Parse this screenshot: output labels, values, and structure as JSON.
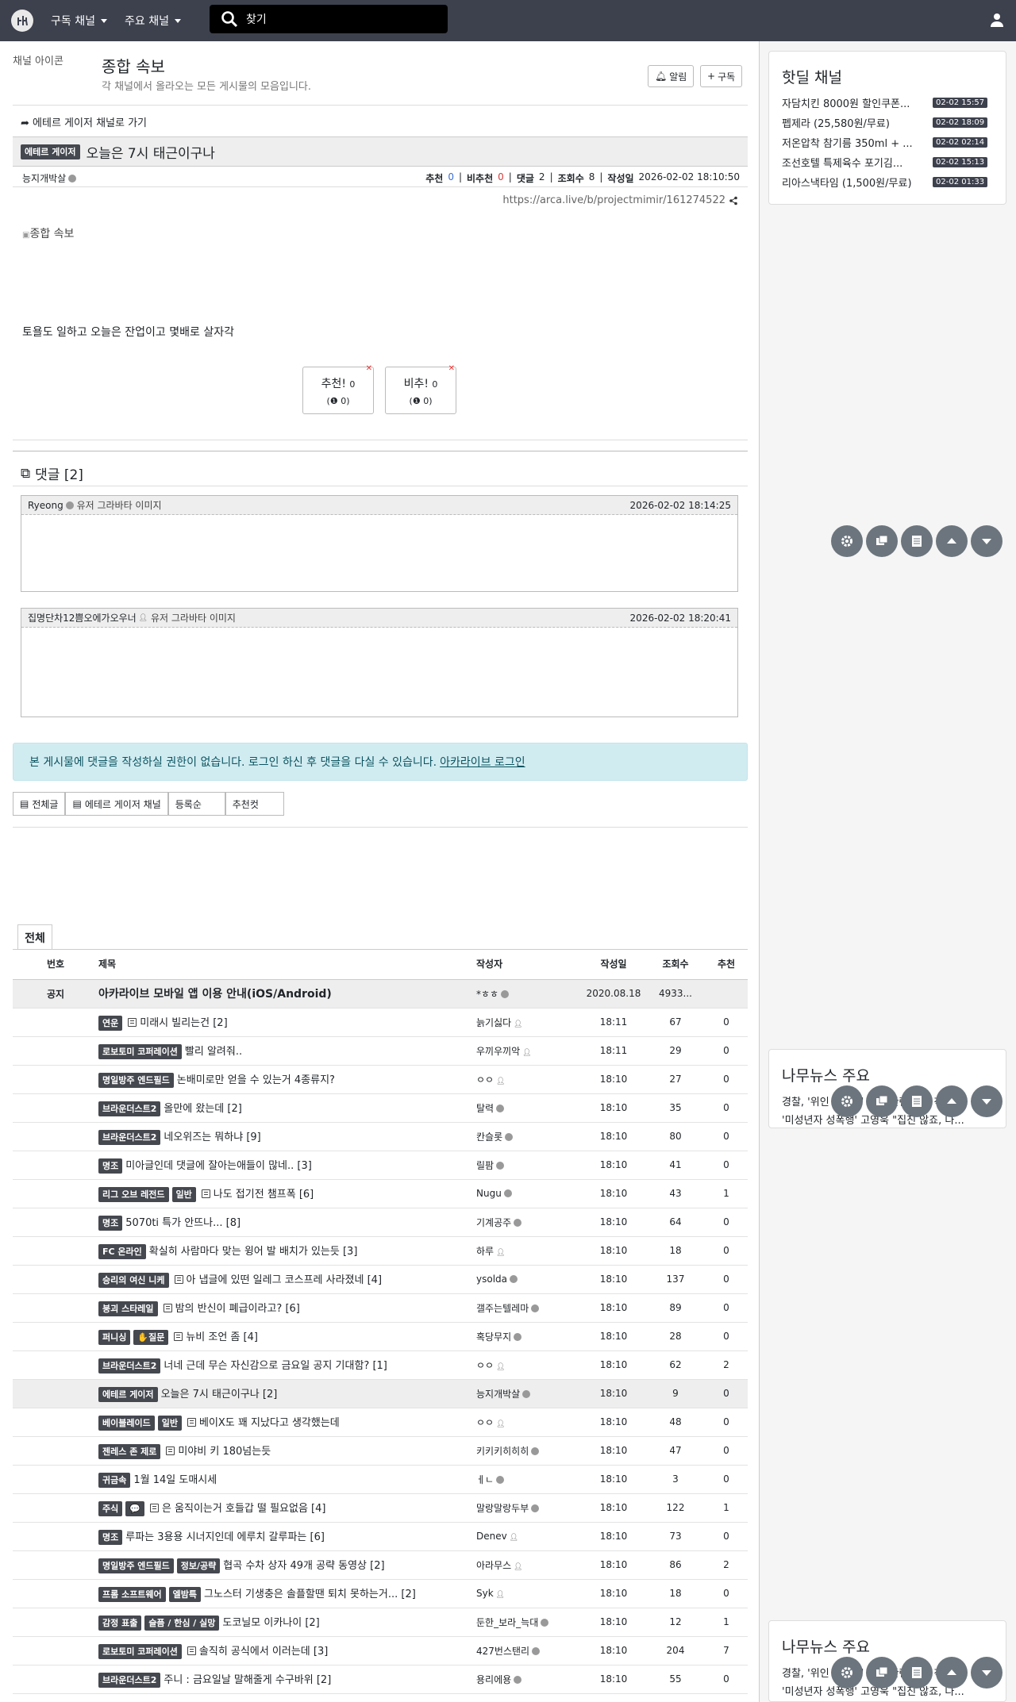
{
  "nav": {
    "menu1": "구독 채널",
    "menu2": "주요 채널",
    "search_placeholder": "찾기"
  },
  "channel": {
    "img_alt": "채널 아이콘",
    "title": "종합 속보",
    "desc": "각 채널에서 올라오는 모든 게시물의 모음입니다.",
    "alarm": "알림",
    "subscribe": "구독"
  },
  "back_link": "에테르 게이저 채널로 가기",
  "article": {
    "category": "에테르 게이저",
    "title": "오늘은 7시 태근이구나",
    "author": "능지개박살",
    "rec_label": "추천",
    "rec": "0",
    "nrec_label": "비추천",
    "nrec": "0",
    "cmt_label": "댓글",
    "cmt": "2",
    "view_label": "조회수",
    "views": "8",
    "date_label": "작성일",
    "date": "2026-02-02 18:10:50",
    "url": "https://arca.live/b/projectmimir/161274522",
    "img_alt": "종합 속보",
    "body": "토욜도 일하고 오늘은 잔업이고 몇배로 살자각",
    "vote_up": "추천!",
    "vote_up_n": "0",
    "vote_up_sub": "0",
    "vote_down": "비추!",
    "vote_down_n": "0",
    "vote_down_sub": "0"
  },
  "comments": {
    "header": "댓글 [2]",
    "items": [
      {
        "author": "Ryeong",
        "avatar_alt": "유저 그라바타 이미지",
        "date": "2026-02-02 18:14:25"
      },
      {
        "author": "집명단차12쁨오에가오우너",
        "avatar_alt": "유저 그라바타 이미지",
        "date": "2026-02-02 18:20:41"
      }
    ]
  },
  "alert": {
    "text": "본 게시물에 댓글을 작성하실 권한이 없습니다. 로그인 하신 후 댓글을 다실 수 있습니다.",
    "link": "아카라이브 로그인"
  },
  "filter_tabs": [
    "전체글",
    "에테르 게이저 채널",
    "등록순",
    "추천컷"
  ],
  "list_tab": "전체",
  "table": {
    "headers": [
      "번호",
      "제목",
      "작성자",
      "작성일",
      "조회수",
      "추천"
    ],
    "notice": {
      "num": "공지",
      "title": "아카라이브 모바일 앱 이용 안내(iOS/Android)",
      "author": "*ㅎㅎ",
      "date": "2020.08.18",
      "views": "4933...",
      "rec": ""
    },
    "rows": [
      {
        "badges": [
          "연운"
        ],
        "doc": true,
        "title": "미래시 빌리는건 [2]",
        "author": "늙기싫다",
        "icon": "person",
        "time": "18:11",
        "views": "67",
        "rec": "0"
      },
      {
        "badges": [
          "로보토미 코퍼레이션"
        ],
        "doc": false,
        "title": "빨리 알려줘..",
        "author": "우끼우끼악",
        "icon": "person",
        "time": "18:11",
        "views": "29",
        "rec": "0"
      },
      {
        "badges": [
          "명일방주 엔드필드"
        ],
        "doc": false,
        "title": "논배미로만 얻을 수 있는거 4종류지?",
        "author": "ㅇㅇ",
        "icon": "person",
        "time": "18:10",
        "views": "27",
        "rec": "0"
      },
      {
        "badges": [
          "브라운더스트2"
        ],
        "doc": false,
        "title": "올만에 왔는데 [2]",
        "author": "탈력",
        "icon": "check",
        "time": "18:10",
        "views": "35",
        "rec": "0"
      },
      {
        "badges": [
          "브라운더스트2"
        ],
        "doc": false,
        "title": "네오위즈는 뭐하냐 [9]",
        "author": "칸슬롯",
        "icon": "check",
        "time": "18:10",
        "views": "80",
        "rec": "0"
      },
      {
        "badges": [
          "명조"
        ],
        "doc": false,
        "title": "미아글인데 댓글에 잘아는애들이 많네.. [3]",
        "author": "릴팜",
        "icon": "check",
        "time": "18:10",
        "views": "41",
        "rec": "0"
      },
      {
        "badges": [
          "리그 오브 레전드",
          "일반"
        ],
        "doc": true,
        "title": "나도 접기전 챔프폭 [6]",
        "author": "Nugu",
        "icon": "check",
        "time": "18:10",
        "views": "43",
        "rec": "1"
      },
      {
        "badges": [
          "명조"
        ],
        "doc": false,
        "title": "5070ti 특가 안뜨나... [8]",
        "author": "기계공주",
        "icon": "check",
        "time": "18:10",
        "views": "64",
        "rec": "0"
      },
      {
        "badges": [
          "FC 온라인"
        ],
        "doc": false,
        "title": "확실히 사람마다 맞는 윙어 발 배치가 있는듯 [3]",
        "author": "하루",
        "icon": "person",
        "time": "18:10",
        "views": "18",
        "rec": "0"
      },
      {
        "badges": [
          "승리의 여신 니케"
        ],
        "doc": true,
        "title": "아 냅글에 있떤 일레그 코스프레 사라졌네 [4]",
        "author": "ysolda",
        "icon": "check",
        "time": "18:10",
        "views": "137",
        "rec": "0"
      },
      {
        "badges": [
          "붕괴 스타레일"
        ],
        "doc": true,
        "title": "밤의 반신이 폐급이라고? [6]",
        "author": "갤주는텔레마",
        "icon": "check",
        "time": "18:10",
        "views": "89",
        "rec": "0"
      },
      {
        "badges": [
          "퍼니싱",
          "✋질문"
        ],
        "doc": true,
        "title": "뉴비 조언 좀 [4]",
        "author": "혹당무지",
        "icon": "check",
        "time": "18:10",
        "views": "28",
        "rec": "0"
      },
      {
        "badges": [
          "브라운더스트2"
        ],
        "doc": false,
        "title": "너네 근데 무슨 자신감으로 금요일 공지 기대함? [1]",
        "author": "ㅇㅇ",
        "icon": "person",
        "time": "18:10",
        "views": "62",
        "rec": "2"
      },
      {
        "badges": [
          "에테르 게이저"
        ],
        "doc": false,
        "title": "오늘은 7시 태근이구나 [2]",
        "author": "능지개박살",
        "icon": "check",
        "time": "18:10",
        "views": "9",
        "rec": "0",
        "hl": true
      },
      {
        "badges": [
          "베이블레이드",
          "일반"
        ],
        "doc": true,
        "title": "베이X도 꽤 지났다고 생각했는데",
        "author": "ㅇㅇ",
        "icon": "person",
        "time": "18:10",
        "views": "48",
        "rec": "0"
      },
      {
        "badges": [
          "젠레스 존 제로"
        ],
        "doc": true,
        "title": "미야비 키 180넘는듯",
        "author": "키키키히히히",
        "icon": "check",
        "time": "18:10",
        "views": "47",
        "rec": "0"
      },
      {
        "badges": [
          "귀금속"
        ],
        "doc": false,
        "title": "1월 14일 도매시세",
        "author": "ㅔㄴ",
        "icon": "check",
        "time": "18:10",
        "views": "3",
        "rec": "0"
      },
      {
        "badges": [
          "주식",
          "💬"
        ],
        "doc": true,
        "title": "은 움직이는거 호들갑 떨 필요없음 [4]",
        "author": "말랑말랑두부",
        "icon": "check",
        "time": "18:10",
        "views": "122",
        "rec": "1"
      },
      {
        "badges": [
          "명조"
        ],
        "doc": false,
        "title": "루파는 3용용 시너지인데 에루치 갈루파는 [6]",
        "author": "Denev",
        "icon": "person",
        "time": "18:10",
        "views": "73",
        "rec": "0"
      },
      {
        "badges": [
          "명일방주 엔드필드",
          "정보/공략"
        ],
        "doc": false,
        "title": "협곡 수차 상자 49개 공략 동영상 [2]",
        "author": "아라무스",
        "icon": "person",
        "time": "18:10",
        "views": "86",
        "rec": "2"
      },
      {
        "badges": [
          "프롬 소프트웨어",
          "엘밤특"
        ],
        "doc": false,
        "title": "그노스터 기생충은 솔플할땐 퇴치 못하는거... [2]",
        "author": "Syk",
        "icon": "person",
        "time": "18:10",
        "views": "18",
        "rec": "0"
      },
      {
        "badges": [
          "감정 표출",
          "슬픔 / 한심 / 실망"
        ],
        "doc": false,
        "title": "도코닐모 이카나이 [2]",
        "author": "둔한_보라_늑대",
        "icon": "check",
        "time": "18:10",
        "views": "12",
        "rec": "1"
      },
      {
        "badges": [
          "로보토미 코퍼레이션"
        ],
        "doc": true,
        "title": "솔직히 공식에서 이러는데 [3]",
        "author": "427번스탠리",
        "icon": "check",
        "time": "18:10",
        "views": "204",
        "rec": "7"
      },
      {
        "badges": [
          "브라운더스트2"
        ],
        "doc": false,
        "title": "주니 : 금요일날 말해줄게 수구바위 [2]",
        "author": "용리에용",
        "icon": "check",
        "time": "18:10",
        "views": "55",
        "rec": "0"
      }
    ]
  },
  "hotdeal": {
    "title": "핫딜 채널",
    "items": [
      {
        "text": "자담치킨 8000원 할인쿠폰...",
        "time": "02-02 15:57"
      },
      {
        "text": "펩제라 (25,580원/무료)",
        "time": "02-02 18:09"
      },
      {
        "text": "저온압착 참기름 350ml + ...",
        "time": "02-02 02:14"
      },
      {
        "text": "조선호텔 특제육수 포기김...",
        "time": "02-02 15:13"
      },
      {
        "text": "리아스낵타임 (1,500원/무료)",
        "time": "02-02 01:33"
      }
    ]
  },
  "news1": {
    "title": "나무뉴스 주요",
    "items": [
      "경찰, '위인 조교수' 사망 관련 내사 착수",
      "'미성년자 성폭행' 고영욱 \"집진 않죠, 나..."
    ]
  },
  "news2": {
    "title": "나무뉴스 주요",
    "items": [
      "경찰, '위인 조교수' 사망 관련 내사 착수",
      "'미성년자 성폭행' 고영욱 \"집진 않죠, 나..."
    ]
  }
}
